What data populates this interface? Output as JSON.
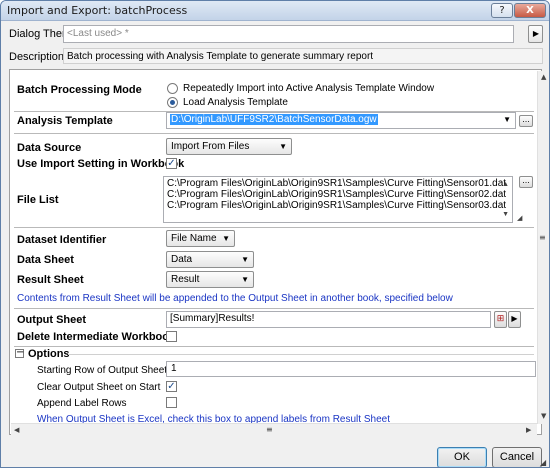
{
  "window": {
    "title": "Import and Export: batchProcess"
  },
  "header": {
    "dialog_theme_label": "Dialog Theme",
    "dialog_theme_value": "<Last used> *",
    "description_label": "Description",
    "description_value": "Batch processing with Analysis Template to generate summary report"
  },
  "form": {
    "batch_mode_label": "Batch Processing Mode",
    "batch_mode_options": [
      "Repeatedly Import into Active Analysis Template Window",
      "Load Analysis Template"
    ],
    "batch_mode_selected": 1,
    "analysis_template_label": "Analysis Template",
    "analysis_template_value": "D:\\OriginLab\\UFF9SR2\\BatchSensorData.ogw",
    "data_source_label": "Data Source",
    "data_source_value": "Import From Files",
    "use_import_label": "Use Import Setting in Workbook",
    "use_import_checked": true,
    "file_list_label": "File List",
    "file_list": [
      "C:\\Program Files\\OriginLab\\Origin9SR1\\Samples\\Curve Fitting\\Sensor01.dat",
      "C:\\Program Files\\OriginLab\\Origin9SR1\\Samples\\Curve Fitting\\Sensor02.dat",
      "C:\\Program Files\\OriginLab\\Origin9SR1\\Samples\\Curve Fitting\\Sensor03.dat"
    ],
    "dataset_identifier_label": "Dataset Identifier",
    "dataset_identifier_value": "File Name",
    "data_sheet_label": "Data Sheet",
    "data_sheet_value": "Data",
    "result_sheet_label": "Result Sheet",
    "result_sheet_value": "Result",
    "result_note": "Contents from Result Sheet will be appended to the Output Sheet in another book, specified below",
    "output_sheet_label": "Output Sheet",
    "output_sheet_value": "[Summary]Results!",
    "delete_intermediate_label": "Delete Intermediate Workbook",
    "delete_intermediate_checked": false,
    "options_label": "Options",
    "options_toggle": "−",
    "starting_row_label": "Starting Row of Output Sheet",
    "starting_row_value": "1",
    "clear_output_label": "Clear Output Sheet on Start",
    "clear_output_checked": true,
    "append_label_rows_label": "Append Label Rows",
    "append_label_rows_checked": false,
    "excel_note": "When Output Sheet is Excel, check this box to append labels from Result Sheet"
  },
  "footer": {
    "ok_label": "OK",
    "cancel_label": "Cancel"
  },
  "icons": {
    "close": "close-icon",
    "help": "help-icon",
    "menu": "arrow-right-icon",
    "browse": "ellipsis-icon",
    "dropdown": "chevron-down-icon"
  },
  "glyphs": {
    "help": "?",
    "close": "X",
    "arrow_right": "▶",
    "dropdown": "▼",
    "ellipsis": "...",
    "check": "✓",
    "scroll_up": "▲",
    "scroll_down": "▼",
    "scroll_left": "◀",
    "scroll_right": "▶",
    "scroll_grip": "≡",
    "resize": "◢",
    "list_resize": "◢",
    "sheet_picker": "⊞"
  }
}
